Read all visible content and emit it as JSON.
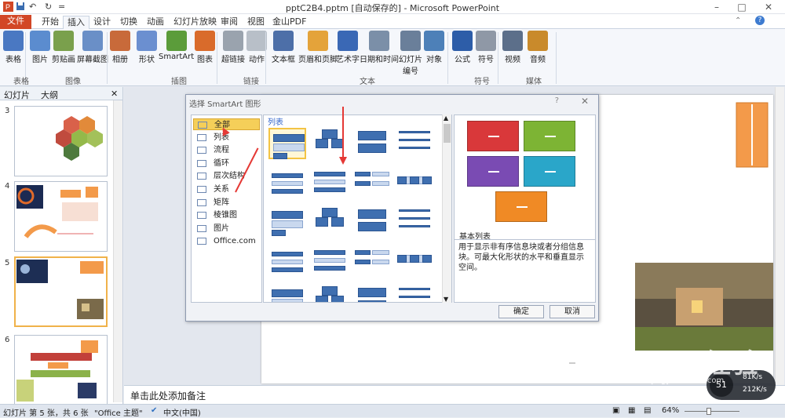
{
  "window": {
    "title": "pptC2B4.pptm [自动保存的] - Microsoft PowerPoint",
    "help": "?"
  },
  "quick_access": {
    "save_icon": "save-icon",
    "undo_icon": "undo-icon",
    "redo_icon": "redo-icon",
    "customize": "="
  },
  "tabs": [
    "文件",
    "开始",
    "插入",
    "设计",
    "切换",
    "动画",
    "幻灯片放映",
    "审阅",
    "视图",
    "金山PDF"
  ],
  "active_tab": "插入",
  "ribbon": {
    "buttons": [
      {
        "label": "表格",
        "icon": "table-icon",
        "color": "#4a78c2"
      },
      {
        "label": "图片",
        "icon": "picture-icon",
        "color": "#5b8ccf"
      },
      {
        "label": "剪贴画",
        "icon": "clipart-icon",
        "color": "#7aa04c"
      },
      {
        "label": "屏幕截图",
        "icon": "screenshot-icon",
        "color": "#6a8fc7"
      },
      {
        "label": "相册",
        "icon": "album-icon",
        "color": "#c86a3a"
      },
      {
        "label": "形状",
        "icon": "shapes-icon",
        "color": "#6b8fd0"
      },
      {
        "label": "SmartArt",
        "icon": "smartart-icon",
        "color": "#5b9c3a"
      },
      {
        "label": "图表",
        "icon": "chart-icon",
        "color": "#d96b2b"
      },
      {
        "label": "超链接",
        "icon": "hyperlink-icon",
        "color": "#9aa3ae"
      },
      {
        "label": "动作",
        "icon": "action-icon",
        "color": "#b8bfc8"
      },
      {
        "label": "文本框",
        "icon": "textbox-icon",
        "color": "#4d6fa8"
      },
      {
        "label": "页眉和页脚",
        "icon": "header-footer-icon",
        "color": "#e4a33a"
      },
      {
        "label": "艺术字",
        "icon": "wordart-icon",
        "color": "#3a68b5"
      },
      {
        "label": "日期和时间",
        "icon": "date-time-icon",
        "color": "#7b8fa8"
      },
      {
        "label": "幻灯片\n编号",
        "icon": "slide-number-icon",
        "color": "#6a7f9a"
      },
      {
        "label": "对象",
        "icon": "object-icon",
        "color": "#4d80b8"
      },
      {
        "label": "公式",
        "icon": "equation-icon",
        "color": "#2d5da8"
      },
      {
        "label": "符号",
        "icon": "symbol-icon",
        "color": "#8f98a6"
      },
      {
        "label": "视频",
        "icon": "video-icon",
        "color": "#5c6f8a"
      },
      {
        "label": "音频",
        "icon": "audio-icon",
        "color": "#c98a2b"
      }
    ],
    "groups": [
      "表格",
      "图像",
      "插图",
      "链接",
      "文本",
      "符号",
      "媒体"
    ]
  },
  "left_panel": {
    "tabs": [
      "幻灯片",
      "大纲"
    ],
    "slide_numbers": [
      "3",
      "4",
      "5",
      "6"
    ],
    "selected": "5"
  },
  "dialog": {
    "title": "选择 SmartArt 图形",
    "categories": [
      "全部",
      "列表",
      "流程",
      "循环",
      "层次结构",
      "关系",
      "矩阵",
      "棱锥图",
      "图片",
      "Office.com"
    ],
    "selected_category": "全部",
    "gallery_header": "列表",
    "preview_title": "基本列表",
    "preview_description": "用于显示非有序信息块或者分组信息块。可最大化形状的水平和垂直显示空间。",
    "ok": "确定",
    "cancel": "取消",
    "preview_colors": [
      "#d9383a",
      "#7db434",
      "#7a4bb3",
      "#2aa6c9",
      "#f08a25"
    ]
  },
  "notes": {
    "placeholder": "单击此处添加备注"
  },
  "status": {
    "slide": "幻灯片 第 5 张，共 6 张",
    "theme": "\"Office 主题\"",
    "language": "中文(中国)",
    "zoom": "64%"
  },
  "overlay": {
    "speed_up": "81K/s",
    "speed_down": "212K/s",
    "counter": "51",
    "watermark": "Baidu 经验",
    "watermark_url": "jingyan.baidu.com"
  }
}
